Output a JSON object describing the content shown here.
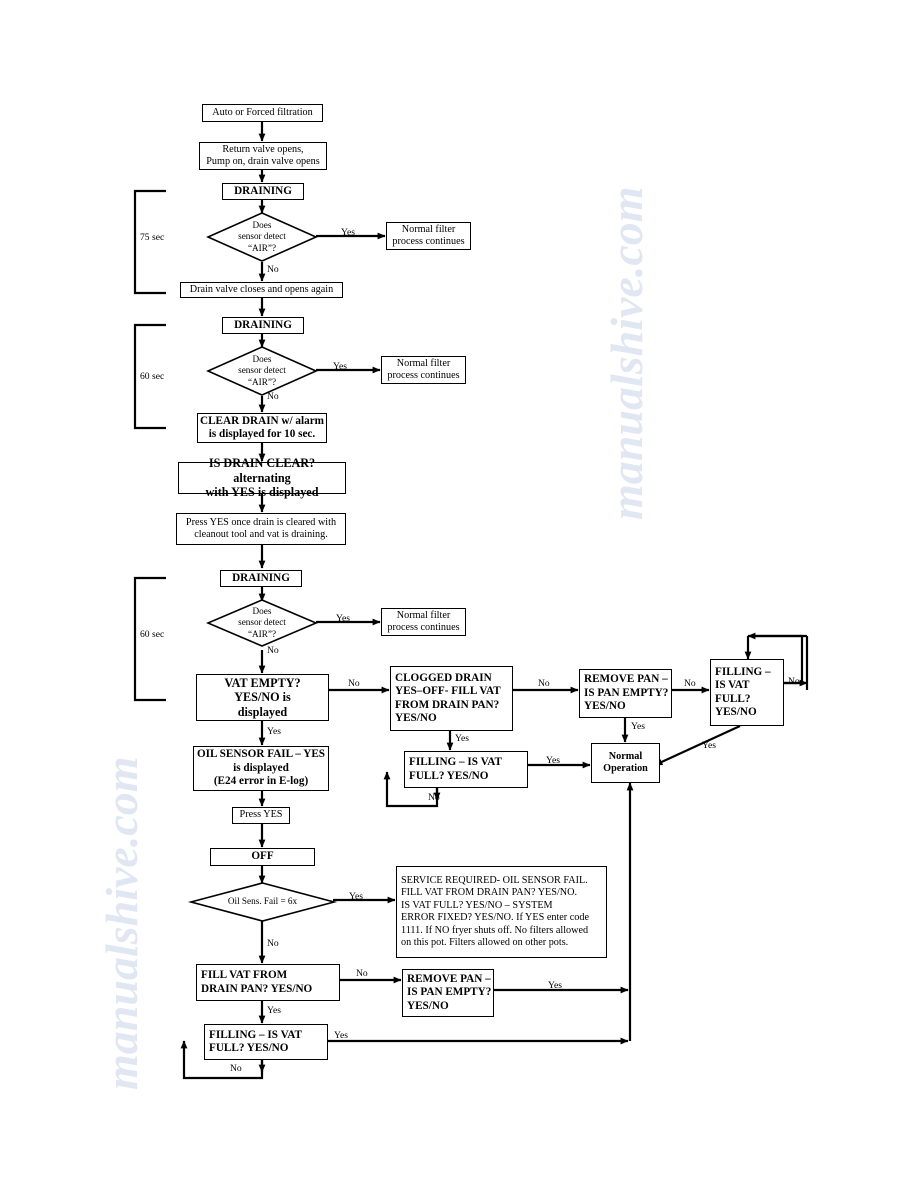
{
  "watermark": {
    "line1": "manualshive.com",
    "line2": "manualshive.com"
  },
  "timing_labels": [
    {
      "id": "t75",
      "text": "75 sec"
    },
    {
      "id": "t60a",
      "text": "60 sec"
    },
    {
      "id": "t60b",
      "text": "60 sec"
    }
  ],
  "nodes": {
    "auto_forced": {
      "label": "Auto or Forced filtration"
    },
    "return_valve": {
      "line1": "Return valve opens,",
      "line2": "Pump on, drain valve opens"
    },
    "draining1": {
      "label": "DRAINING"
    },
    "normal_filter1": {
      "line1": "Normal filter",
      "line2": "process continues"
    },
    "drain_valve_closes": {
      "label": "Drain valve closes and opens again"
    },
    "draining2": {
      "label": "DRAINING"
    },
    "normal_filter2": {
      "line1": "Normal filter",
      "line2": "process continues"
    },
    "clear_drain": {
      "line1": "CLEAR DRAIN w/ alarm",
      "line2": "is displayed for 10 sec."
    },
    "is_drain_clear": {
      "line1": "IS DRAIN CLEAR? alternating",
      "line2": "with YES is displayed"
    },
    "press_yes_once": {
      "line1": "Press YES once drain is cleared with",
      "line2": "cleanout tool and vat is draining."
    },
    "draining3": {
      "label": "DRAINING"
    },
    "normal_filter3": {
      "line1": "Normal filter",
      "line2": "process continues"
    },
    "vat_empty": {
      "line1": "VAT EMPTY?",
      "line2": "YES/NO is",
      "line3": "displayed"
    },
    "clogged_drain": {
      "line1": "CLOGGED DRAIN",
      "line2": "YES–OFF- FILL VAT",
      "line3": "FROM DRAIN PAN?",
      "line4": "YES/NO"
    },
    "remove_pan_top": {
      "line1": "REMOVE PAN –",
      "line2": "IS PAN EMPTY?",
      "line3": "YES/NO"
    },
    "filling_right": {
      "line1": "FILLING –",
      "line2": "IS VAT",
      "line3": "FULL?",
      "line4": "YES/NO"
    },
    "oil_sensor_fail": {
      "line1": "OIL SENSOR FAIL – YES",
      "line2": "is displayed",
      "line3": "(E24 error in E-log)"
    },
    "filling_mid": {
      "line1": "FILLING – IS VAT",
      "line2": "FULL? YES/NO"
    },
    "normal_operation": {
      "line1": "Normal",
      "line2": "Operation"
    },
    "press_yes": {
      "label": "Press YES"
    },
    "off": {
      "label": "OFF"
    },
    "service_required": {
      "line1": "SERVICE REQUIRED- OIL SENSOR FAIL.",
      "line2": "FILL VAT FROM DRAIN PAN? YES/NO.",
      "line3": "IS VAT FULL?  YES/NO – SYSTEM",
      "line4": "ERROR FIXED? YES/NO.  If YES enter code",
      "line5": "1111.  If NO fryer shuts off. No filters allowed",
      "line6": "on this pot. Filters allowed on other pots."
    },
    "fill_vat_from": {
      "line1": "FILL VAT FROM",
      "line2": "DRAIN PAN? YES/NO"
    },
    "remove_pan_bottom": {
      "line1": "REMOVE PAN –",
      "line2": "IS PAN EMPTY?",
      "line3": "YES/NO"
    },
    "filling_bottom": {
      "line1": "FILLING – IS VAT",
      "line2": "FULL? YES/NO"
    }
  },
  "decisions": {
    "air1": {
      "line1": "Does",
      "line2": "sensor detect",
      "line3": "“AIR”?"
    },
    "air2": {
      "line1": "Does",
      "line2": "sensor detect",
      "line3": "“AIR”?"
    },
    "air3": {
      "line1": "Does",
      "line2": "sensor detect",
      "line3": "“AIR”?"
    },
    "oil_sens_fail_6x": {
      "line1": "Oil Sens. Fail = 6x"
    }
  },
  "edge_labels": [
    {
      "id": "e1",
      "text": "Yes"
    },
    {
      "id": "e2",
      "text": "No"
    },
    {
      "id": "e3",
      "text": "Yes"
    },
    {
      "id": "e4",
      "text": "No"
    },
    {
      "id": "e5",
      "text": "Yes"
    },
    {
      "id": "e6",
      "text": "No"
    },
    {
      "id": "e7",
      "text": "No"
    },
    {
      "id": "e8",
      "text": "No"
    },
    {
      "id": "e9",
      "text": "No"
    },
    {
      "id": "e10",
      "text": "No"
    },
    {
      "id": "e11",
      "text": "Yes"
    },
    {
      "id": "e12",
      "text": "Yes"
    },
    {
      "id": "e13",
      "text": "Yes"
    },
    {
      "id": "e14",
      "text": "Yes"
    },
    {
      "id": "e15",
      "text": "Yes"
    },
    {
      "id": "e16",
      "text": "No"
    },
    {
      "id": "e17",
      "text": "Yes"
    },
    {
      "id": "e18",
      "text": "No"
    },
    {
      "id": "e19",
      "text": "No"
    },
    {
      "id": "e20",
      "text": "Yes"
    },
    {
      "id": "e21",
      "text": "Yes"
    },
    {
      "id": "e22",
      "text": "Yes"
    },
    {
      "id": "e23",
      "text": "No"
    }
  ],
  "colors": {
    "stroke": "#000000",
    "background": "#ffffff",
    "watermark": "#c9d4e8"
  }
}
